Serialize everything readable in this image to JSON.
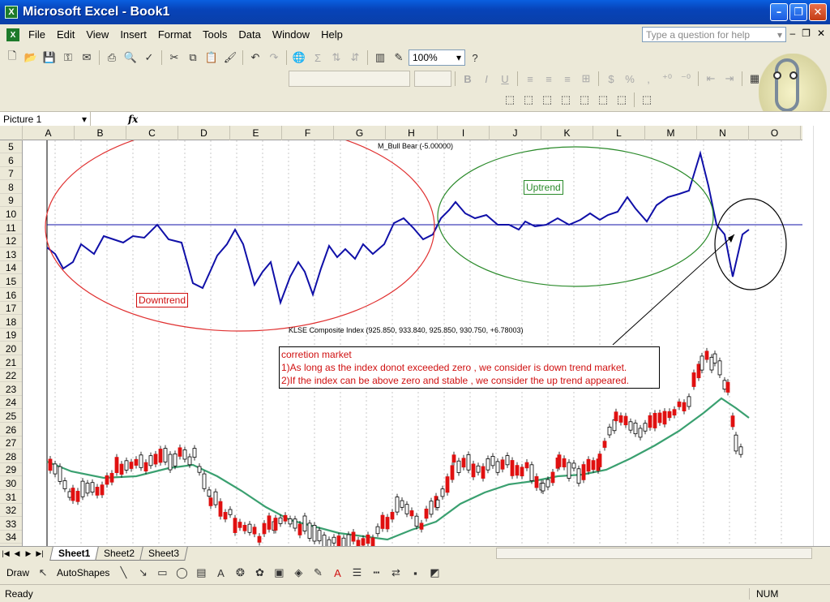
{
  "window": {
    "title": "Microsoft Excel - Book1",
    "icon": "excel-icon"
  },
  "menu": [
    "File",
    "Edit",
    "View",
    "Insert",
    "Format",
    "Tools",
    "Data",
    "Window",
    "Help"
  ],
  "help_placeholder": "Type a question for help",
  "zoom": "100%",
  "namebox": "Picture 1",
  "fx": "fx",
  "columns": [
    "A",
    "B",
    "C",
    "D",
    "E",
    "F",
    "G",
    "H",
    "I",
    "J",
    "K",
    "L",
    "M",
    "N",
    "O"
  ],
  "rows": [
    "5",
    "6",
    "7",
    "8",
    "9",
    "10",
    "11",
    "12",
    "13",
    "14",
    "15",
    "16",
    "17",
    "18",
    "19",
    "20",
    "21",
    "22",
    "23",
    "24",
    "25",
    "26",
    "27",
    "28",
    "29",
    "30",
    "31",
    "32",
    "33",
    "34"
  ],
  "charts": {
    "indicator_title": "M_Bull Bear (-5.00000)",
    "price_title": "KLSE Composite Index (925.850, 933.840, 925.850, 930.750, +6.78003)",
    "downtrend": "Downtrend",
    "uptrend": "Uptrend",
    "callout": {
      "line1": "corretion market",
      "line2": "1)As long as the index donot exceeded zero , we consider is down trend market.",
      "line3": "2)If the index can be above zero and stable , we consider the up trend appeared."
    }
  },
  "tabs": [
    "Sheet1",
    "Sheet2",
    "Sheet3"
  ],
  "drawbar": {
    "draw": "Draw",
    "autoshapes": "AutoShapes"
  },
  "status": {
    "left": "Ready",
    "num": "NUM"
  },
  "colors": {
    "indicator": "#1010a8",
    "zero_line": "#1010a8",
    "downtrend": "#e03030",
    "uptrend": "#2a8a2a",
    "ma_line": "#3aa070",
    "up_candle": "#000000",
    "down_candle": "#e01010"
  }
}
